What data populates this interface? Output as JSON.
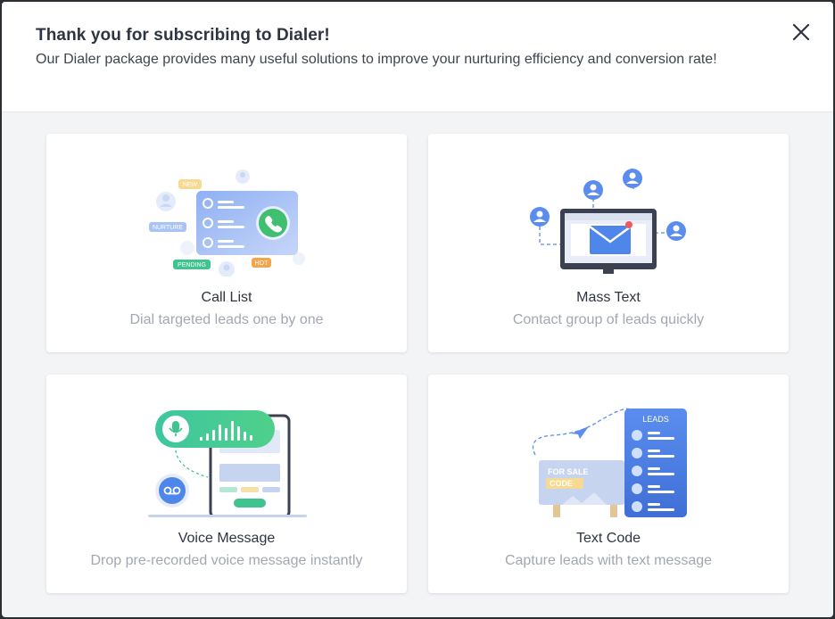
{
  "dialog": {
    "title": "Thank you for subscribing to Dialer!",
    "subtitle": "Our Dialer package provides many useful solutions to improve your nurturing efficiency and conversion rate!"
  },
  "cards": [
    {
      "title": "Call List",
      "description": "Dial targeted leads one by one",
      "icon": "call-list-illustration",
      "tags": [
        "NEW",
        "NURTURE",
        "PENDING",
        "HOT"
      ]
    },
    {
      "title": "Mass Text",
      "description": "Contact group of leads quickly",
      "icon": "mass-text-illustration"
    },
    {
      "title": "Voice Message",
      "description": "Drop pre-recorded voice message instantly",
      "icon": "voice-message-illustration"
    },
    {
      "title": "Text Code",
      "description": "Capture leads with text message",
      "icon": "text-code-illustration",
      "labels": [
        "LEADS",
        "FOR SALE",
        "CODE"
      ]
    }
  ],
  "colors": {
    "accent_blue": "#5b8def",
    "accent_green": "#3fc38f",
    "accent_orange": "#f2a54a",
    "text_dark": "#2f3442",
    "text_muted": "#a2a7b1"
  }
}
